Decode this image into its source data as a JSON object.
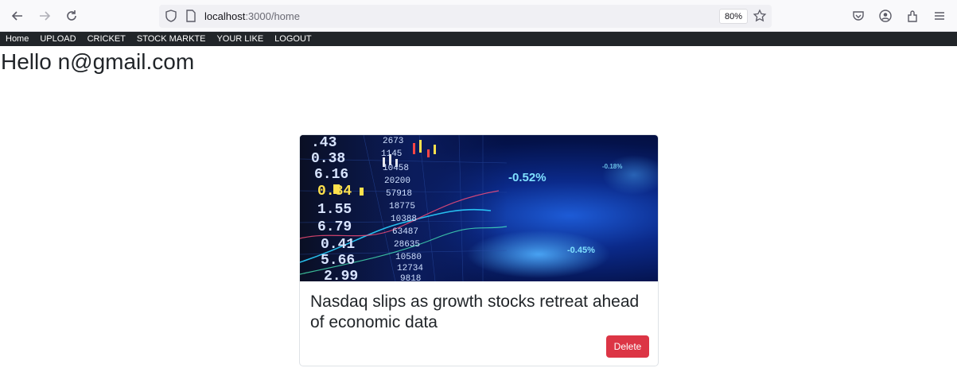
{
  "browser": {
    "url_host": "localhost",
    "url_path": ":3000/home",
    "zoom": "80%"
  },
  "nav": {
    "items": [
      "Home",
      "UPLOAD",
      "CRICKET",
      "STOCK MARKTE",
      "YOUR LIKE",
      "LOGOUT"
    ]
  },
  "greeting": "Hello n@gmail.com",
  "card": {
    "title": "Nasdaq slips as growth stocks retreat ahead of economic data",
    "delete_label": "Delete",
    "image_text": {
      "left_numbers": [
        ".43",
        "0.38",
        "6.16",
        "0.34",
        "1.55",
        "6.79",
        "0.41",
        "5.66",
        "2.99"
      ],
      "middle_numbers": [
        "2673",
        "1145",
        "10458",
        "20200",
        "57918",
        "18775",
        "10388",
        "63487",
        "28635",
        "10580",
        "12734",
        "9818"
      ],
      "right_percents": [
        "-0.52%",
        "-0.45%",
        "-0.18%"
      ]
    }
  }
}
